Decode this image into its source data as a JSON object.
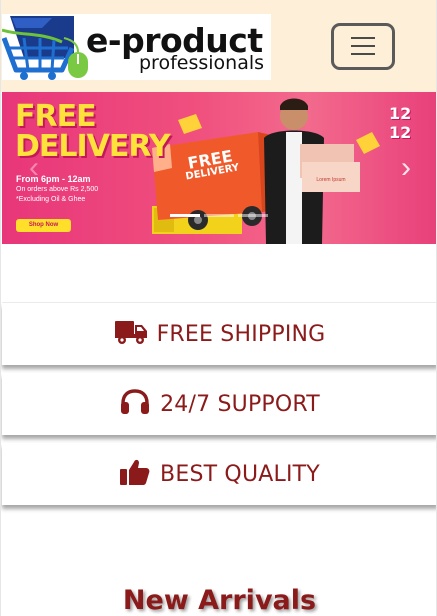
{
  "header": {
    "logo": {
      "line1": "e-product",
      "line2": "professionals"
    },
    "menu_toggle": {
      "icon": "hamburger-icon"
    }
  },
  "banner": {
    "headline": [
      "FREE",
      "DELIVERY"
    ],
    "hours": "From 6pm - 12am",
    "condition": "On orders above Rs 2,500",
    "exclusion": "*Excluding Oil & Ghee",
    "cta": "Shop Now",
    "badge": "12 12",
    "truck_text": [
      "FREE",
      "DELIVERY"
    ],
    "colors": {
      "background": "#e8367a",
      "headline": "#ffe13b",
      "truck": "#f05a2a"
    },
    "prev_icon": "chevron-left-icon",
    "next_icon": "chevron-right-icon",
    "indicators": [
      {
        "active": true
      },
      {
        "active": false
      },
      {
        "active": false
      }
    ]
  },
  "features": [
    {
      "icon": "truck-icon",
      "label": "FREE SHIPPING"
    },
    {
      "icon": "headset-icon",
      "label": "24/7 SUPPORT"
    },
    {
      "icon": "thumbs-up-icon",
      "label": "BEST QUALITY"
    }
  ],
  "section": {
    "title": "New Arrivals"
  },
  "colors": {
    "header_bg": "#fdefd8",
    "accent": "#8b1a1a"
  }
}
